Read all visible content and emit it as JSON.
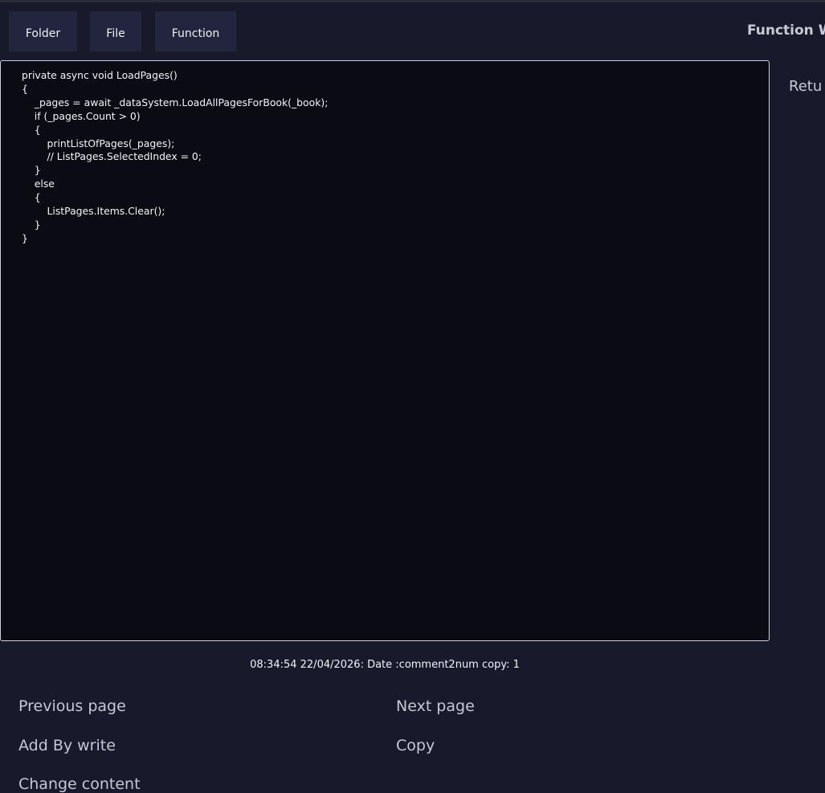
{
  "toolbar": {
    "folder_label": "Folder",
    "file_label": "File",
    "function_label": "Function"
  },
  "window": {
    "title": "Function W"
  },
  "side_panel": {
    "label": "Retu"
  },
  "editor": {
    "code": "private async void LoadPages()\n{\n    _pages = await _dataSystem.LoadAllPagesForBook(_book);\n    if (_pages.Count > 0)\n    {\n        printListOfPages(_pages);\n        // ListPages.SelectedIndex = 0;\n    }\n    else\n    {\n        ListPages.Items.Clear();\n    }\n}"
  },
  "status": {
    "text": "08:34:54 22/04/2026: Date :comment2num copy: 1"
  },
  "actions": {
    "previous_page": "Previous page",
    "next_page": "Next page",
    "add_by_write": "Add By write",
    "copy": "Copy",
    "change_content": "Change content"
  },
  "colors": {
    "background": "#181a2c",
    "button_bg": "#22253d",
    "editor_bg": "#0a0b15",
    "editor_border": "#cfd0dc",
    "link_text": "#c6c7d2"
  }
}
